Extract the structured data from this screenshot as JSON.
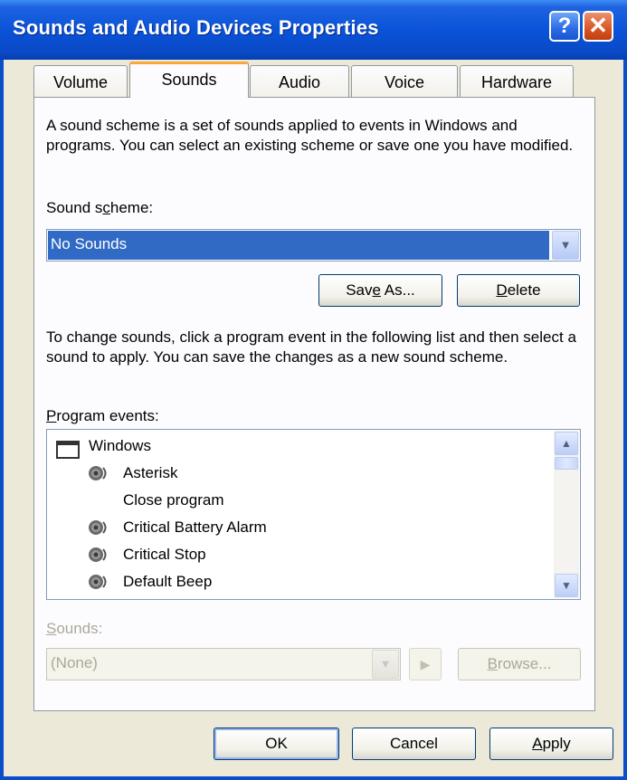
{
  "window": {
    "title": "Sounds and Audio Devices Properties",
    "help_symbol": "?",
    "close_symbol": "✕"
  },
  "tabs": [
    {
      "label": "Volume",
      "active": false
    },
    {
      "label": "Sounds",
      "active": true
    },
    {
      "label": "Audio",
      "active": false
    },
    {
      "label": "Voice",
      "active": false
    },
    {
      "label": "Hardware",
      "active": false
    }
  ],
  "scheme": {
    "description": "A sound scheme is a set of sounds applied to events in Windows and programs. You can select an existing scheme or save one you have modified.",
    "label_pre": "Sound s",
    "label_key": "c",
    "label_post": "heme:",
    "selected": "No Sounds",
    "save_as_pre": "Sav",
    "save_as_key": "e",
    "save_as_post": " As...",
    "delete_key": "D",
    "delete_post": "elete"
  },
  "events": {
    "description": "To change sounds, click a program event in the following list and then select a sound to apply. You can save the changes as a new sound scheme.",
    "label_key": "P",
    "label_post": "rogram events:",
    "items": [
      {
        "label": "Windows",
        "type": "group"
      },
      {
        "label": "Asterisk",
        "type": "sound"
      },
      {
        "label": "Close program",
        "type": "none"
      },
      {
        "label": "Critical Battery Alarm",
        "type": "sound"
      },
      {
        "label": "Critical Stop",
        "type": "sound"
      },
      {
        "label": "Default Beep",
        "type": "sound"
      }
    ]
  },
  "sounds": {
    "label_key": "S",
    "label_post": "ounds:",
    "selected": "(None)",
    "browse_key": "B",
    "browse_post": "rowse..."
  },
  "footer": {
    "ok": "OK",
    "cancel": "Cancel",
    "apply_key": "A",
    "apply_post": "pply"
  },
  "colors": {
    "titlebar": "#0a53d9",
    "selection": "#316ac5",
    "face": "#ece9d8"
  }
}
